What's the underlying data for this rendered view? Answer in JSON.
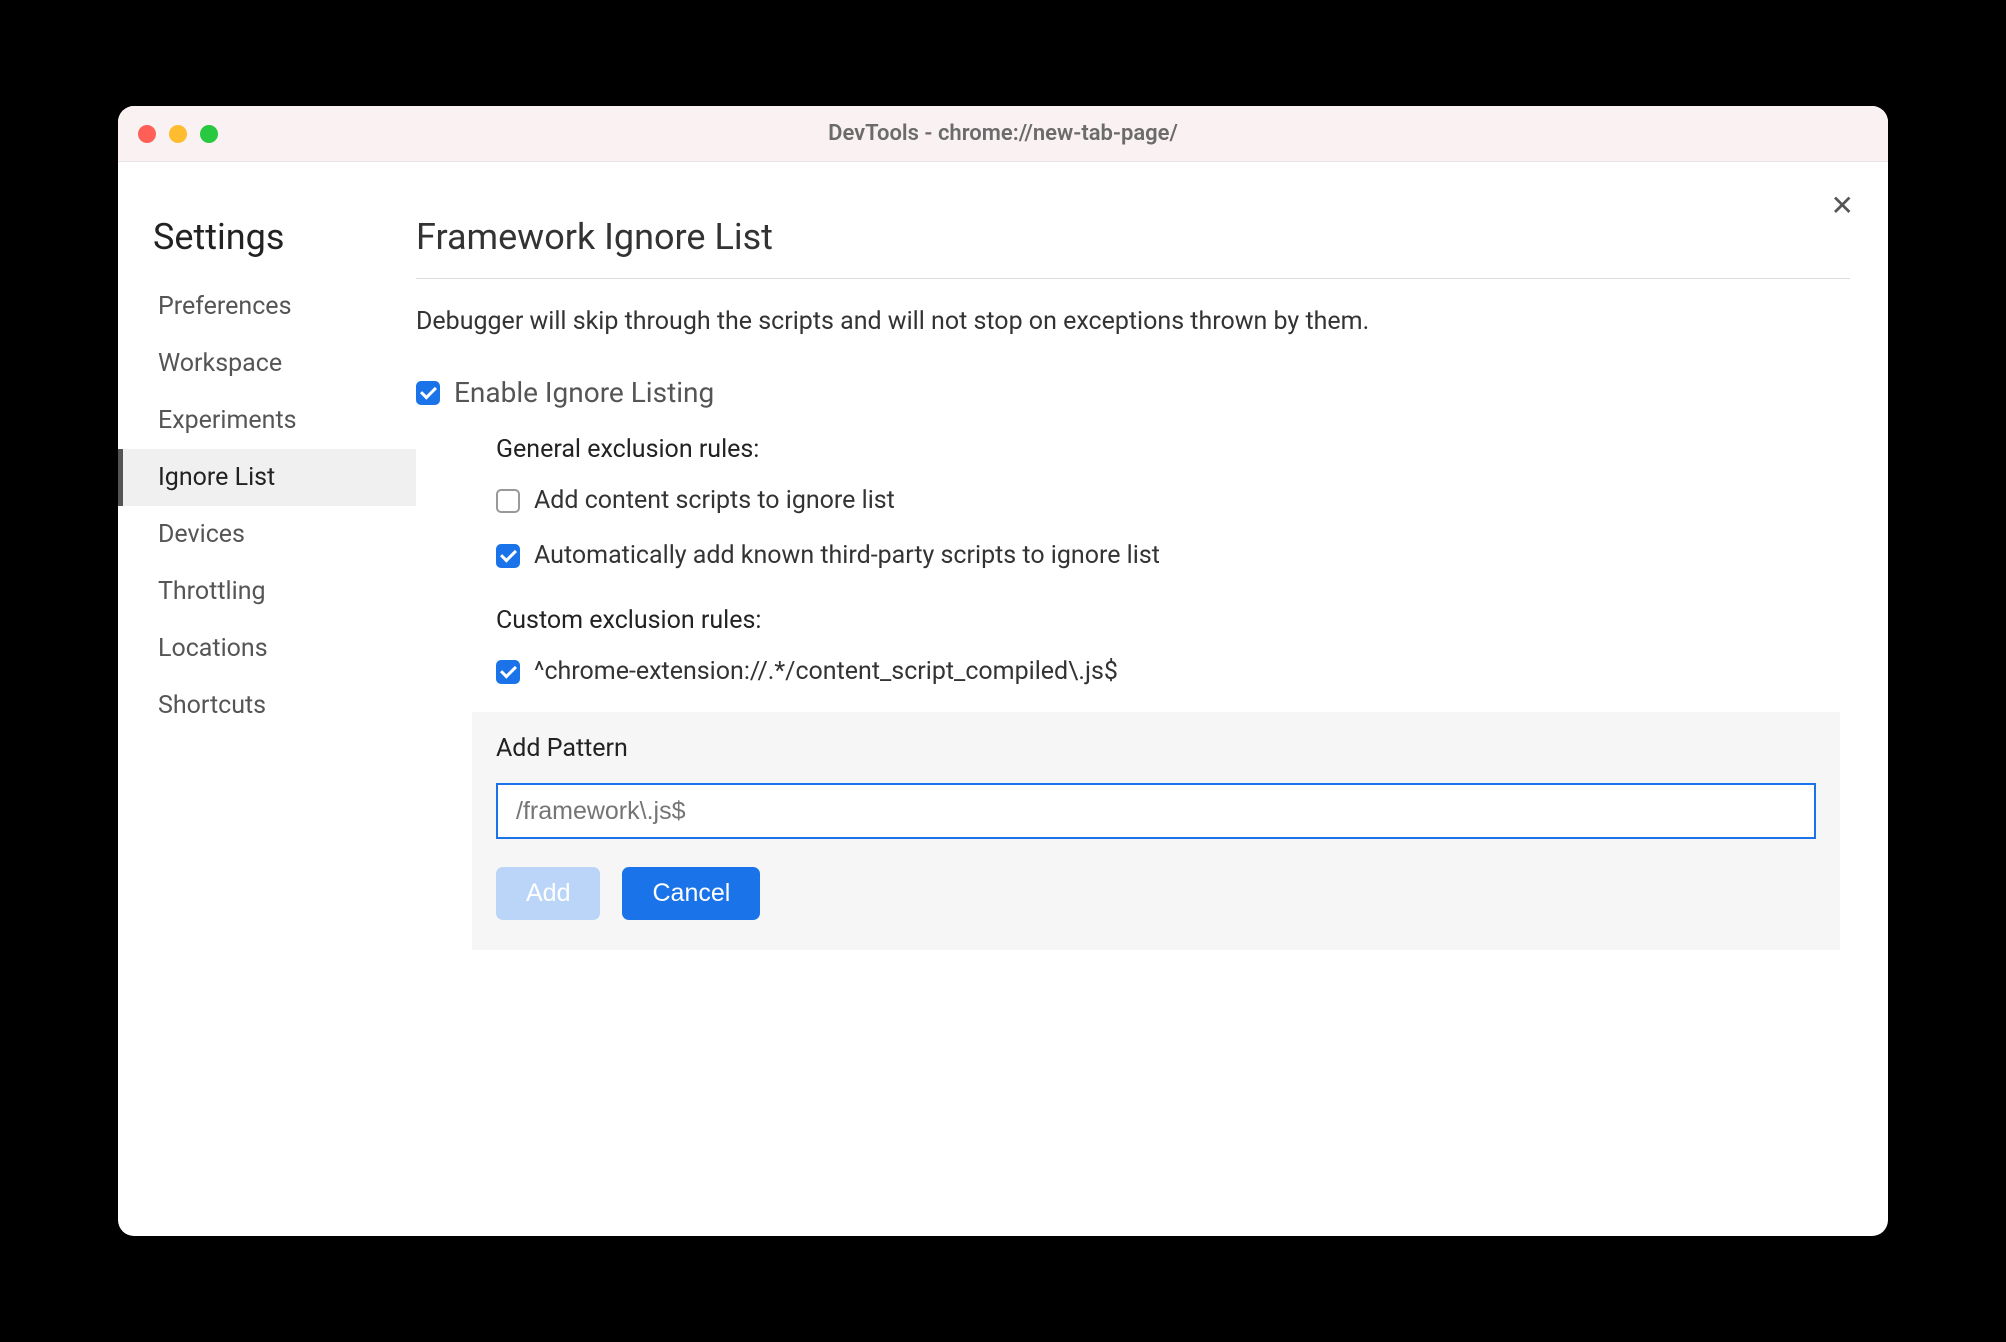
{
  "window": {
    "title": "DevTools - chrome://new-tab-page/"
  },
  "sidebar": {
    "title": "Settings",
    "items": [
      {
        "label": "Preferences",
        "active": false
      },
      {
        "label": "Workspace",
        "active": false
      },
      {
        "label": "Experiments",
        "active": false
      },
      {
        "label": "Ignore List",
        "active": true
      },
      {
        "label": "Devices",
        "active": false
      },
      {
        "label": "Throttling",
        "active": false
      },
      {
        "label": "Locations",
        "active": false
      },
      {
        "label": "Shortcuts",
        "active": false
      }
    ]
  },
  "main": {
    "title": "Framework Ignore List",
    "description": "Debugger will skip through the scripts and will not stop on exceptions thrown by them.",
    "enable_label": "Enable Ignore Listing",
    "enable_checked": true,
    "general": {
      "title": "General exclusion rules:",
      "rules": [
        {
          "label": "Add content scripts to ignore list",
          "checked": false
        },
        {
          "label": "Automatically add known third-party scripts to ignore list",
          "checked": true
        }
      ]
    },
    "custom": {
      "title": "Custom exclusion rules:",
      "rules": [
        {
          "label": "^chrome-extension://.*/content_script_compiled\\.js$",
          "checked": true
        }
      ]
    },
    "add_pattern": {
      "title": "Add Pattern",
      "placeholder": "/framework\\.js$",
      "add_label": "Add",
      "cancel_label": "Cancel"
    }
  },
  "close_label": "✕"
}
